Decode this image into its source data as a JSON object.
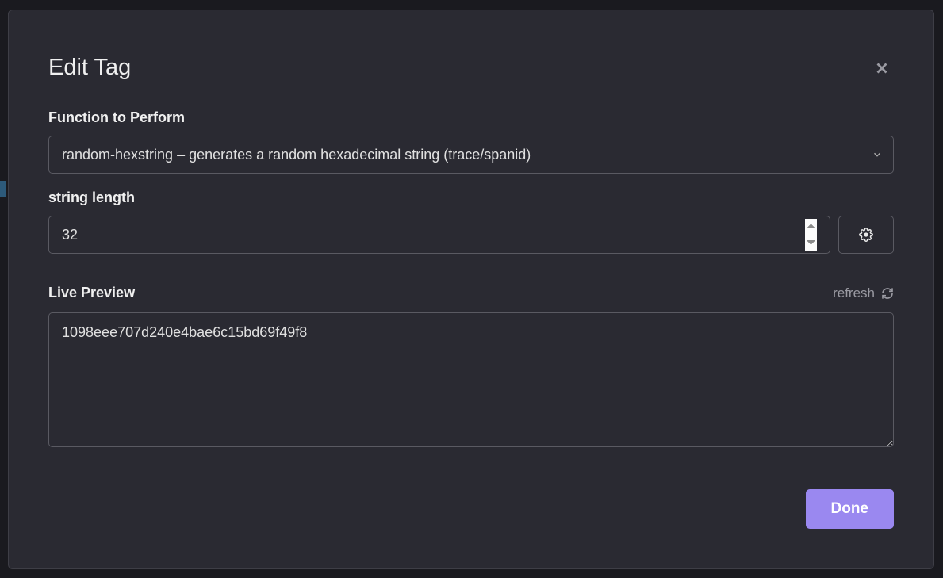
{
  "modal": {
    "title": "Edit Tag",
    "function": {
      "label": "Function to Perform",
      "selected": "random-hexstring – generates a random hexadecimal string (trace/spanid)"
    },
    "stringLength": {
      "label": "string length",
      "value": "32"
    },
    "preview": {
      "label": "Live Preview",
      "refresh": "refresh",
      "value": "1098eee707d240e4bae6c15bd69f49f8"
    },
    "done": "Done"
  }
}
